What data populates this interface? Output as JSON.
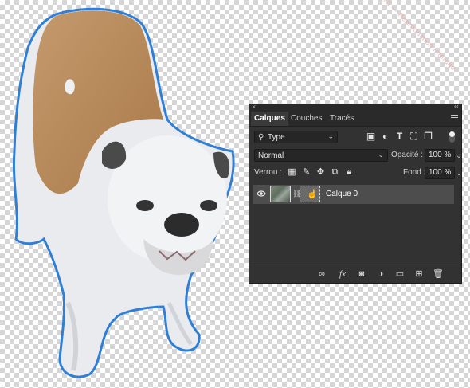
{
  "panel": {
    "close_glyph": "×",
    "collapse_glyph": "‹‹",
    "tabs": [
      {
        "label": "Calques",
        "active": true
      },
      {
        "label": "Couches",
        "active": false
      },
      {
        "label": "Tracés",
        "active": false
      }
    ],
    "menu_icon": "panel-menu-icon"
  },
  "filter": {
    "kind_label": "Type",
    "icons": [
      "image-filter-icon",
      "adjustment-filter-icon",
      "text-filter-icon",
      "shape-filter-icon",
      "smart-object-filter-icon"
    ]
  },
  "blend": {
    "mode": "Normal",
    "opacity_label": "Opacité :",
    "opacity_value": "100 %"
  },
  "lock": {
    "label": "Verrou :",
    "icons": [
      "lock-transparent-pixels-icon",
      "lock-image-pixels-icon",
      "lock-position-icon",
      "lock-artboard-icon",
      "lock-all-icon"
    ],
    "fill_label": "Fond :",
    "fill_value": "100 %"
  },
  "layers": [
    {
      "name": "Calque 0",
      "visible": true,
      "has_mask": true,
      "selected": true
    }
  ],
  "footer_icons": [
    "link-layers-icon",
    "fx-icon",
    "add-mask-icon",
    "new-adjustment-icon",
    "new-group-icon",
    "new-layer-icon",
    "delete-layer-icon"
  ],
  "colors": {
    "panel_bg": "#323232",
    "selected_row": "#4d4d4d",
    "selection_outline": "#2f7fd6"
  },
  "canvas": {
    "transparency_pattern": "checkerboard",
    "subject": "bulldog"
  }
}
